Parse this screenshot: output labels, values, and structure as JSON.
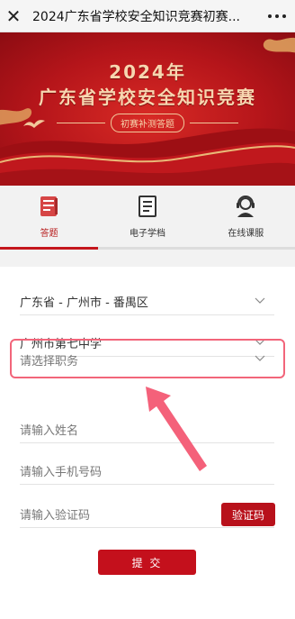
{
  "topbar": {
    "title": "2024广东省学校安全知识竞赛初赛...",
    "close_icon": "close-icon",
    "more_icon": "more-dots-icon"
  },
  "banner": {
    "year": "2024年",
    "title": "广东省学校安全知识竞赛",
    "subtitle": "初赛补测答题"
  },
  "tabs": [
    {
      "label": "答题",
      "icon": "answer-sheet-icon",
      "active": true
    },
    {
      "label": "电子学档",
      "icon": "document-icon",
      "active": false
    },
    {
      "label": "在线课服",
      "icon": "support-agent-icon",
      "active": false
    }
  ],
  "form": {
    "region": "广东省 - 广州市 - 番禺区",
    "school": "广州市第七中学",
    "position_placeholder": "请选择职务",
    "name_placeholder": "请输入姓名",
    "phone_placeholder": "请输入手机号码",
    "code_placeholder": "请输入验证码",
    "code_button": "验证码",
    "submit_button": "提 交"
  },
  "colors": {
    "primary_red": "#c4101c",
    "highlight_pink": "#f2657a",
    "banner_red": "#b5151a",
    "gold_text": "#f7d6b0"
  }
}
